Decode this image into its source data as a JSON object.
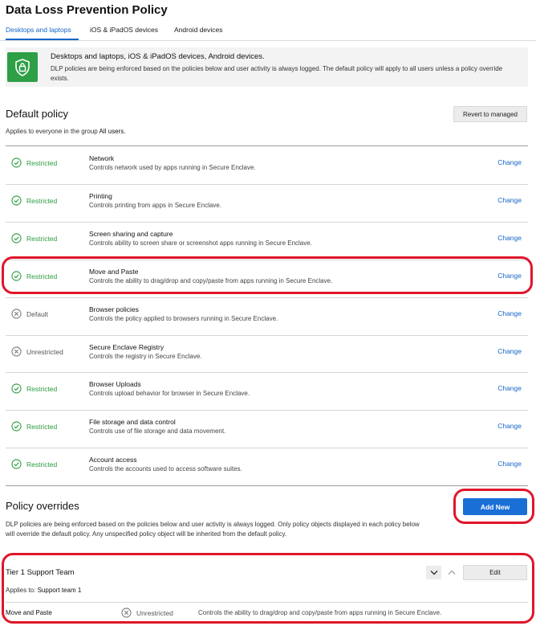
{
  "page": {
    "title": "Data Loss Prevention Policy"
  },
  "tabs": [
    {
      "label": "Desktops and laptops",
      "active": true
    },
    {
      "label": "iOS & iPadOS devices",
      "active": false
    },
    {
      "label": "Android devices",
      "active": false
    }
  ],
  "banner": {
    "title": "Desktops and laptops, iOS & iPadOS devices, Android devices.",
    "description": "DLP policies are being enforced based on the policies below and user activity is always logged. The default policy will apply to all users unless a policy override exists.",
    "icon": "shield-lock-icon"
  },
  "default_policy": {
    "title": "Default policy",
    "applies_prefix": "Applies to everyone in the group",
    "applies_group": "All users.",
    "revert_label": "Revert to managed",
    "change_label": "Change",
    "rows": [
      {
        "status": "Restricted",
        "name": "Network",
        "desc": "Controls network used by apps running in Secure Enclave."
      },
      {
        "status": "Restricted",
        "name": "Printing",
        "desc": "Controls printing from apps in Secure Enclave."
      },
      {
        "status": "Restricted",
        "name": "Screen sharing and capture",
        "desc": "Controls ability to screen share or screenshot apps running in Secure Enclave."
      },
      {
        "status": "Restricted",
        "name": "Move and Paste",
        "desc": "Controls the ability to drag/drop and copy/paste from apps running in Secure Enclave."
      },
      {
        "status": "Default",
        "name": "Browser policies",
        "desc": "Controls the policy applied to browsers running in Secure Enclave."
      },
      {
        "status": "Unrestricted",
        "name": "Secure Enclave Registry",
        "desc": "Controls the registry in Secure Enclave."
      },
      {
        "status": "Restricted",
        "name": "Browser Uploads",
        "desc": "Controls upload behavior for browser in Secure Enclave."
      },
      {
        "status": "Restricted",
        "name": "File storage and data control",
        "desc": "Controls use of file storage and data movement."
      },
      {
        "status": "Restricted",
        "name": "Account access",
        "desc": "Controls the accounts used to access software suites."
      }
    ]
  },
  "overrides": {
    "title": "Policy overrides",
    "add_label": "Add New",
    "description": "DLP policies are being enforced based on the policies below and user activity is always logged. Only policy objects displayed in each policy below will override the default policy. Any unspecified policy object will be inherited from the default policy.",
    "items": [
      {
        "title": "Tier 1 Support Team",
        "applies_prefix": "Applies to:",
        "applies_group": "Support team 1",
        "edit_label": "Edit",
        "row": {
          "name": "Move and Paste",
          "status": "Unrestricted",
          "desc": "Controls the ability to drag/drop and copy/paste from apps running in Secure Enclave."
        }
      }
    ]
  },
  "colors": {
    "accent_blue": "#1465c7",
    "button_blue": "#1a6fd6",
    "restricted_green": "#2b9b3f",
    "highlight_red": "#e0162b",
    "banner_icon_green": "#2e9f45"
  }
}
